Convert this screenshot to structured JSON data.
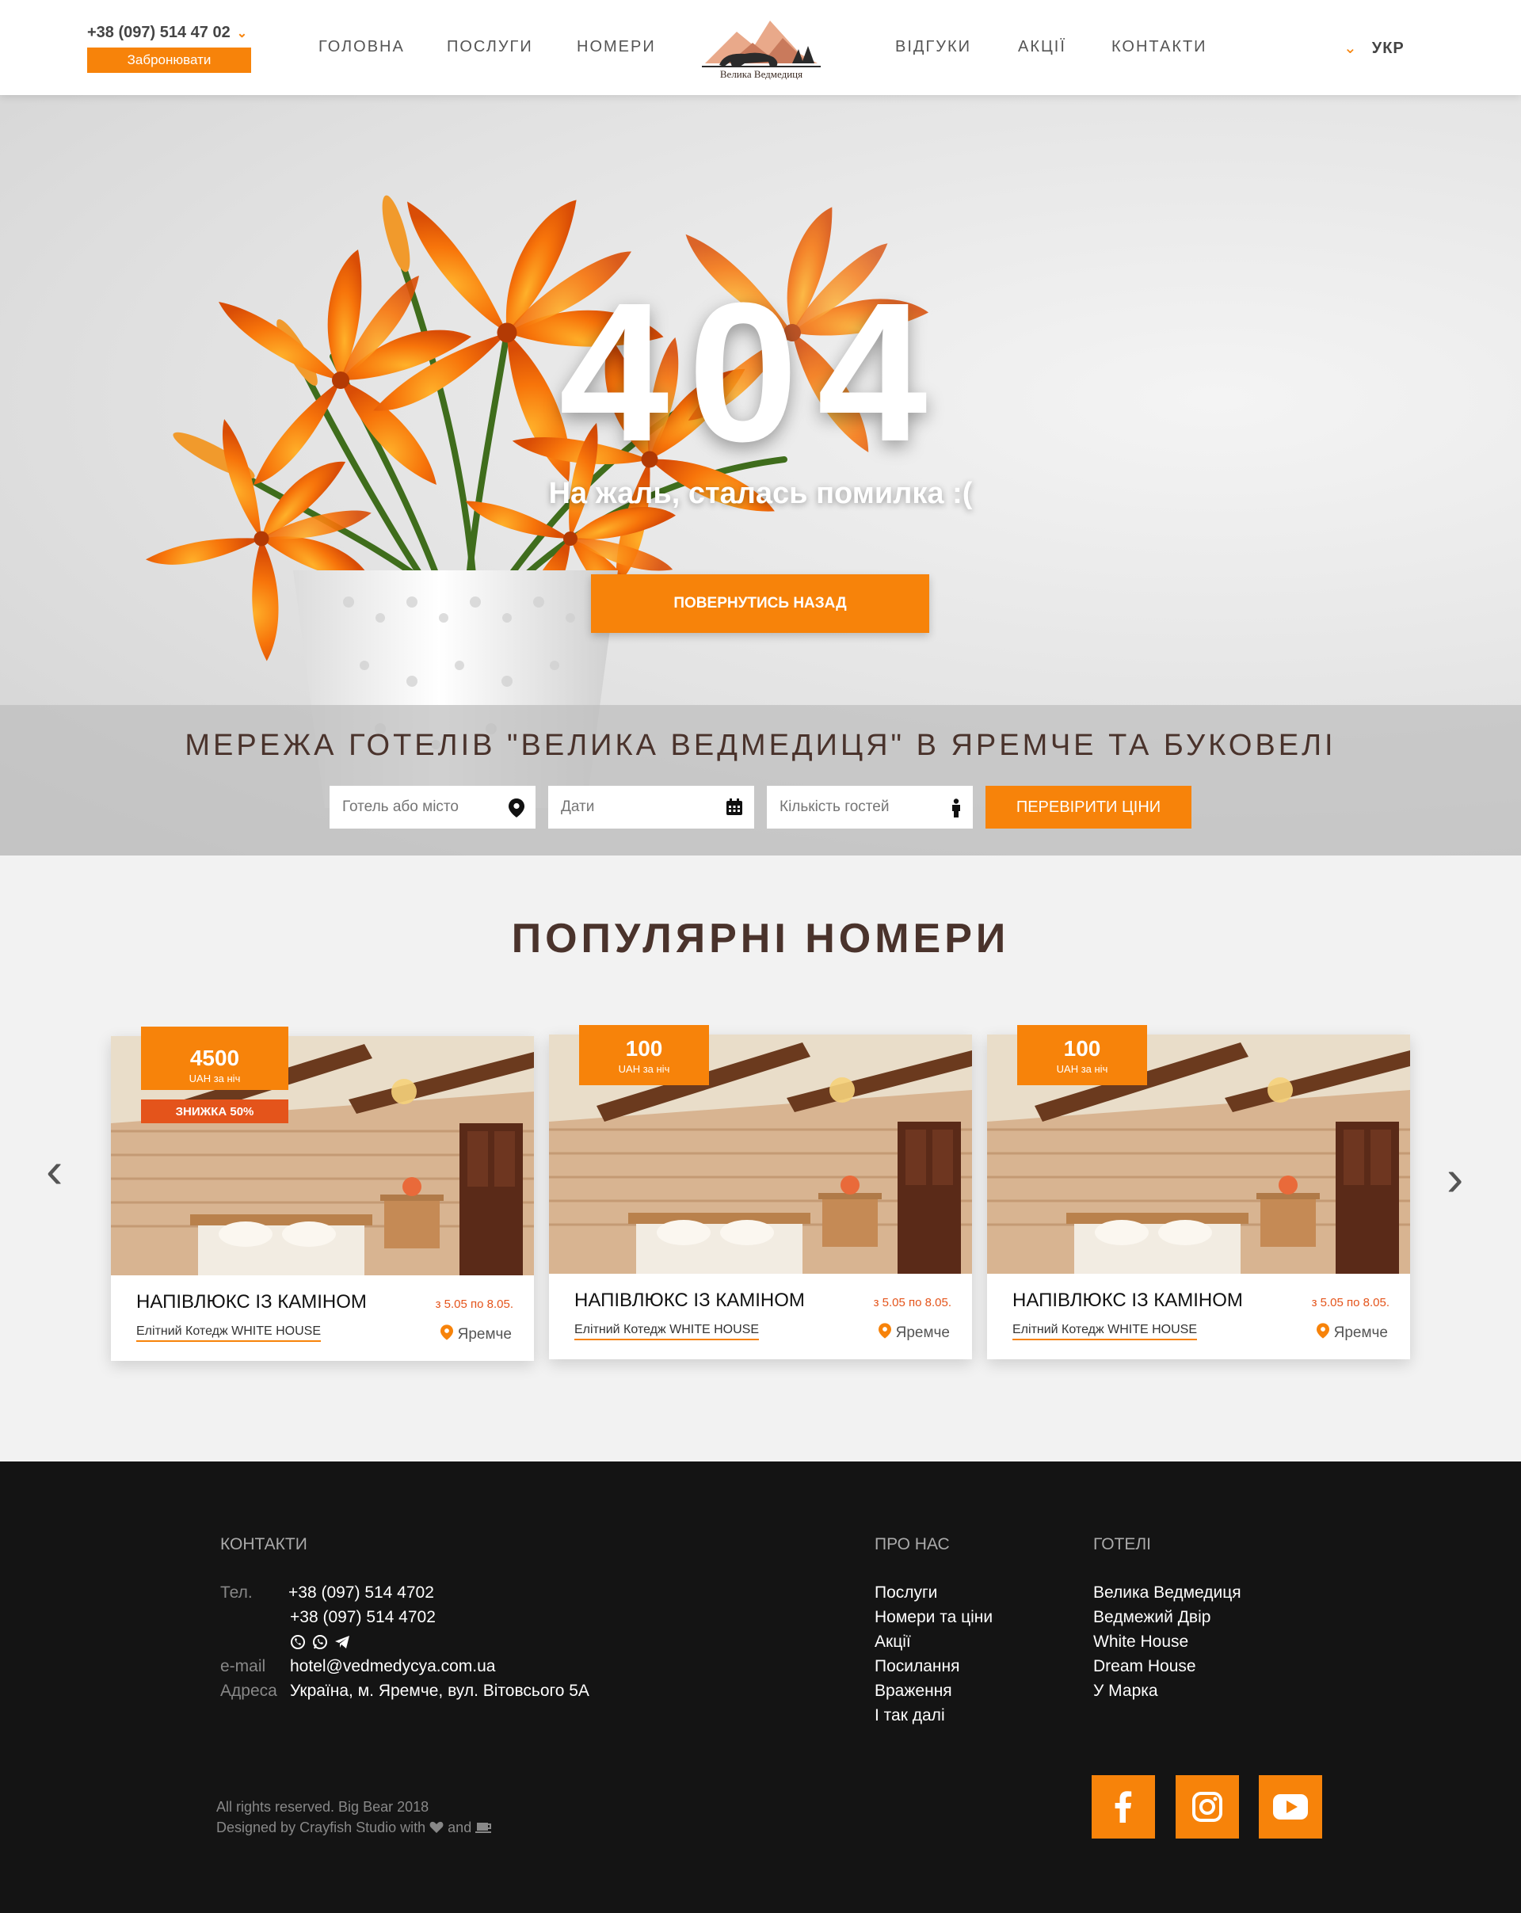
{
  "header": {
    "phone": "+38 (097) 514 47 02",
    "book_label": "Забронювати",
    "nav": [
      "Головна",
      "Послуги",
      "Номери",
      "Відгуки",
      "Акції",
      "Контакти"
    ],
    "logo_text": "Велика Ведмедиця",
    "language": "УКР"
  },
  "hero": {
    "code": "404",
    "message": "На жаль, сталась помилка :(",
    "back_label": "ПОВЕРНУТИСЬ НАЗАД"
  },
  "search": {
    "title": "МЕРЕЖА ГОТЕЛІВ \"ВЕЛИКА ВЕДМЕДИЦЯ\" В ЯРЕМЧЕ ТА БУКОВЕЛІ",
    "hotel_placeholder": "Готель або місто",
    "dates_placeholder": "Дати",
    "guests_placeholder": "Кількість гостей",
    "check_label": "ПЕРЕВІРИТИ ЦІНИ"
  },
  "popular": {
    "title": "ПОПУЛЯРНІ НОМЕРИ",
    "cards": [
      {
        "price": "4500",
        "unit": "UAH за ніч",
        "discount": "ЗНИЖКА 50%",
        "name": "НАПІВЛЮКС ІЗ КАМІНОМ",
        "dates": "з 5.05 по 8.05.",
        "hotel": "Елітний Котедж WHITE HOUSE",
        "city": "Яремче"
      },
      {
        "price": "100",
        "unit": "UAH за ніч",
        "discount": "",
        "name": "НАПІВЛЮКС ІЗ КАМІНОМ",
        "dates": "з 5.05 по 8.05.",
        "hotel": "Елітний Котедж WHITE HOUSE",
        "city": "Яремче"
      },
      {
        "price": "100",
        "unit": "UAH за ніч",
        "discount": "",
        "name": "НАПІВЛЮКС ІЗ КАМІНОМ",
        "dates": "з 5.05 по 8.05.",
        "hotel": "Елітний Котедж WHITE HOUSE",
        "city": "Яремче"
      }
    ]
  },
  "footer": {
    "contacts_title": "КОНТАКТИ",
    "tel_label": "Тел.",
    "phone1": "+38 (097) 514 4702",
    "phone2": "+38 (097) 514 4702",
    "email_label": "e-mail",
    "email": "hotel@vedmedycya.com.ua",
    "address_label": "Адреса",
    "address": "Україна, м. Яремче, вул. Вітовсього 5А",
    "about_title": "ПРО НАС",
    "about_links": [
      "Послуги",
      "Номери та ціни",
      "Акції",
      "Посилання",
      "Враження",
      "І так далі"
    ],
    "hotels_title": "ГОТЕЛІ",
    "hotels_links": [
      "Велика Ведмедиця",
      "Ведмежий Двір",
      "White House",
      "Dream House",
      "У Марка"
    ],
    "rights": "All rights reserved. Big Bear 2018",
    "designed_prefix": "Designed by Crayfish Studio with",
    "designed_and": "and"
  },
  "colors": {
    "accent": "#f7830a",
    "accent_red": "#e4541b",
    "brown": "#4a332c",
    "footer_bg": "#141414"
  }
}
